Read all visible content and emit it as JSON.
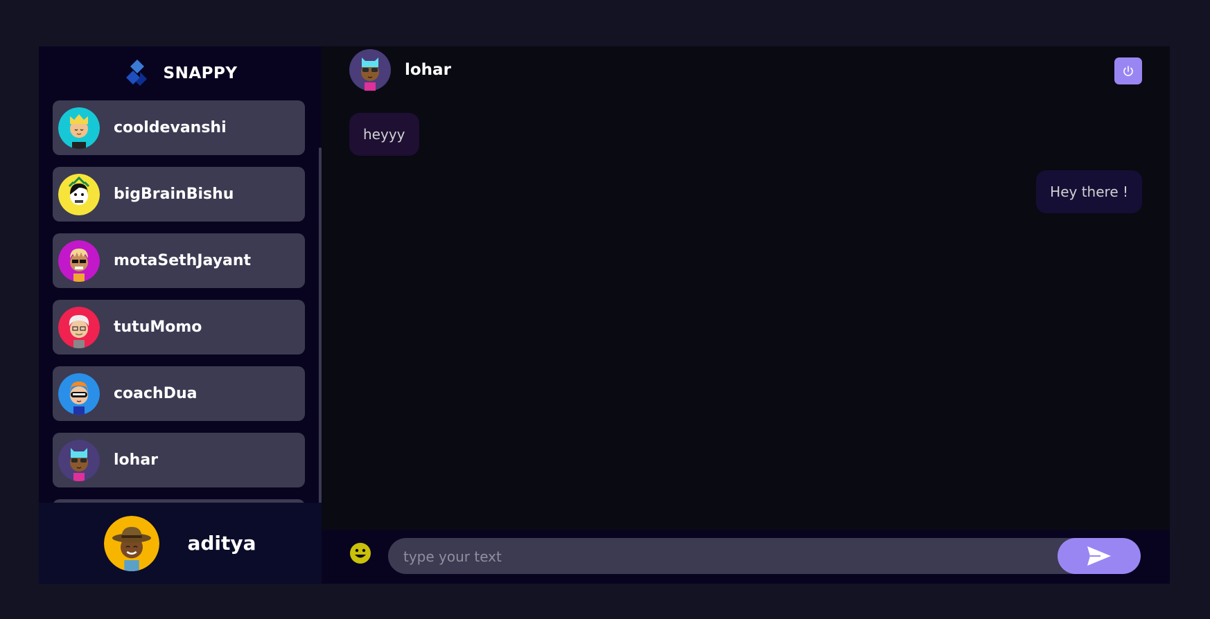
{
  "brand": {
    "name": "SNAPPY"
  },
  "contacts": [
    {
      "name": "cooldevanshi"
    },
    {
      "name": "bigBrainBishu"
    },
    {
      "name": "motaSethJayant"
    },
    {
      "name": "tutuMomo"
    },
    {
      "name": "coachDua"
    },
    {
      "name": "lohar"
    }
  ],
  "current_user": {
    "name": "aditya"
  },
  "chat": {
    "contact_name": "lohar",
    "messages": [
      {
        "text": "heyyy",
        "direction": "received"
      },
      {
        "text": "Hey there !",
        "direction": "sent"
      }
    ],
    "input_placeholder": "type your text"
  },
  "colors": {
    "accent": "#9a86f3",
    "card": "#3c3b52",
    "sidebar_bg": "#080420"
  },
  "icons": {
    "brand": "snappy-logo-icon",
    "logout": "power-icon",
    "emoji": "smiley-icon",
    "send": "paper-plane-icon"
  }
}
